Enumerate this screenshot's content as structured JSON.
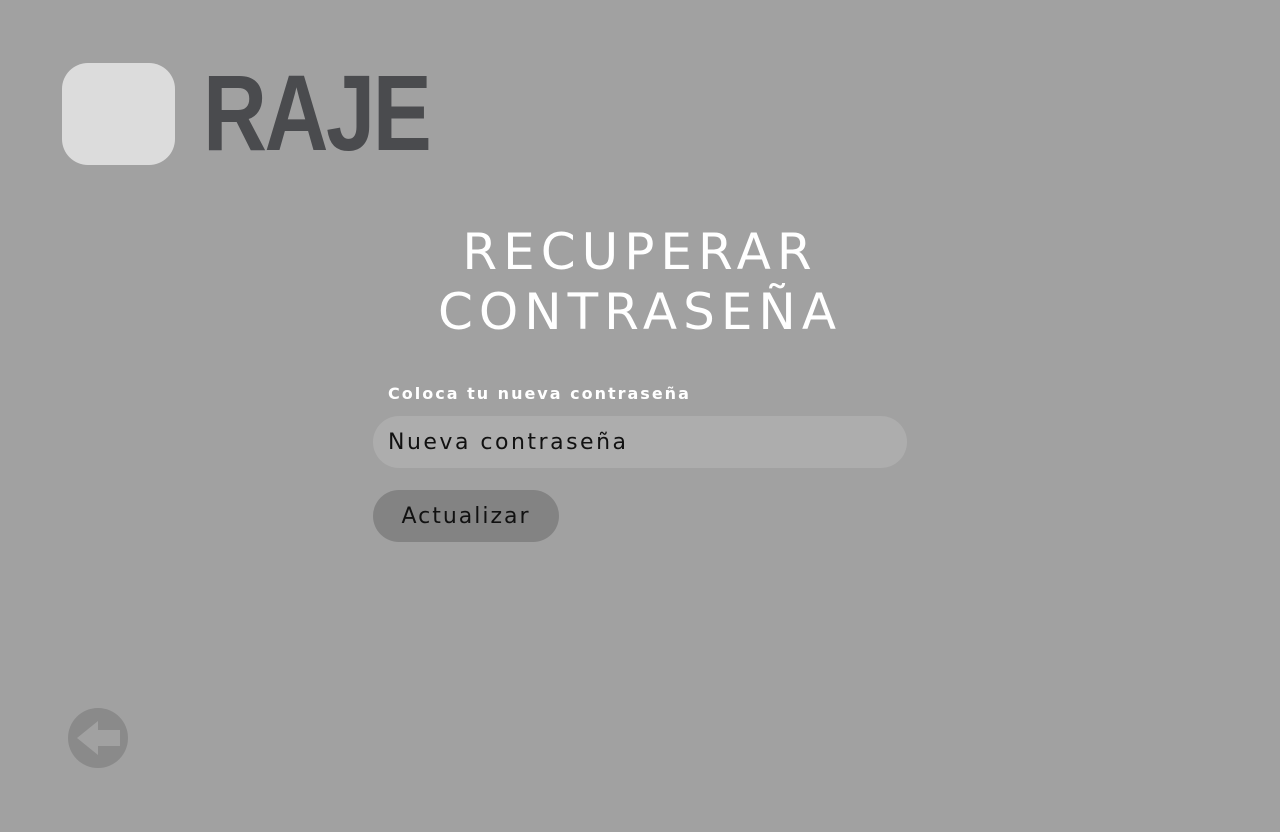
{
  "brand": {
    "name": "RAJE",
    "logo_icon": "rounded-square-logo"
  },
  "title": {
    "line1": "RECUPERAR",
    "line2": "CONTRASEÑA"
  },
  "form": {
    "label": "Coloca tu nueva contraseña",
    "input_placeholder": "Nueva contraseña",
    "input_value": "",
    "submit_label": "Actualizar"
  },
  "navigation": {
    "back_icon": "arrow-left-circle-icon"
  },
  "colors": {
    "background": "#a1a1a1",
    "logo_square": "#dcdcdc",
    "logo_text": "#4a4b4e",
    "input_bg": "#adadad",
    "button_bg": "#838383",
    "back_button_bg": "#8a8a8a",
    "title_text": "#ffffff"
  }
}
